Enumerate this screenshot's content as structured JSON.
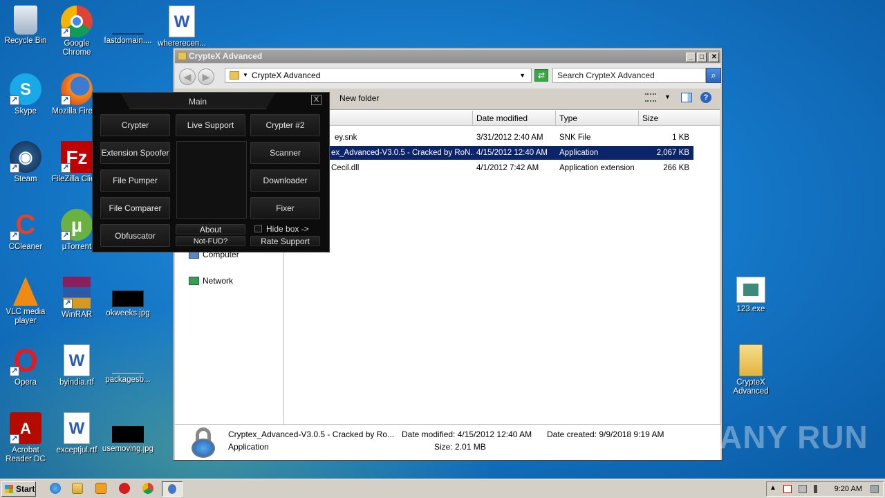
{
  "desktop_icons": [
    {
      "label": "Recycle Bin",
      "icon": "recycle-bin-icon"
    },
    {
      "label": "Google Chrome",
      "icon": "chrome-icon"
    },
    {
      "label": "fastdomain....",
      "icon": "image-file-icon"
    },
    {
      "label": "wherereceп...",
      "icon": "word-doc-icon"
    },
    {
      "label": "Skype",
      "icon": "skype-icon"
    },
    {
      "label": "Mozilla Firef...",
      "icon": "firefox-icon"
    },
    {
      "label": "Steam",
      "icon": "steam-icon"
    },
    {
      "label": "FileZilla Clie...",
      "icon": "filezilla-icon"
    },
    {
      "label": "CCleaner",
      "icon": "ccleaner-icon"
    },
    {
      "label": "µTorrent",
      "icon": "utorrent-icon"
    },
    {
      "label": "VLC media player",
      "icon": "vlc-icon"
    },
    {
      "label": "WinRAR",
      "icon": "winrar-icon"
    },
    {
      "label": "okweeks.jpg",
      "icon": "image-file-icon"
    },
    {
      "label": "Opera",
      "icon": "opera-icon"
    },
    {
      "label": "byindia.rtf",
      "icon": "word-doc-icon"
    },
    {
      "label": "packagesb...",
      "icon": "image-file-icon"
    },
    {
      "label": "Acrobat Reader DC",
      "icon": "acrobat-icon"
    },
    {
      "label": "exceptjul.rtf",
      "icon": "word-doc-icon"
    },
    {
      "label": "usemoving.jpg",
      "icon": "image-file-icon"
    },
    {
      "label": "123.exe",
      "icon": "exe-file-icon"
    },
    {
      "label": "CrypteX Advanced",
      "icon": "folder-icon"
    }
  ],
  "explorer": {
    "title": "CrypteX Advanced",
    "address": "CrypteX Advanced",
    "search_placeholder": "Search CrypteX Advanced",
    "toolbar": {
      "new_folder": "New folder"
    },
    "nav": [
      {
        "label": "Computer"
      },
      {
        "label": "Network"
      }
    ],
    "columns": [
      "Date modified",
      "Type",
      "Size"
    ],
    "files": [
      {
        "name": "ey.snk",
        "date": "3/31/2012 2:40 AM",
        "type": "SNK File",
        "size": "1 KB",
        "selected": false
      },
      {
        "name": "ex_Advanced-V3.0.5 - Cracked by RoN...",
        "date": "4/15/2012 12:40 AM",
        "type": "Application",
        "size": "2,067 KB",
        "selected": true
      },
      {
        "name": "Cecil.dll",
        "date": "4/1/2012 7:42 AM",
        "type": "Application extension",
        "size": "266 KB",
        "selected": false
      }
    ],
    "details": {
      "filename": "Cryptex_Advanced-V3.0.5 - Cracked by Ro...",
      "type": "Application",
      "modified": "Date modified: 4/15/2012 12:40 AM",
      "size": "Size: 2.01 MB",
      "created": "Date created: 9/9/2018 9:19 AM"
    }
  },
  "crypter": {
    "title": "Main",
    "close": "X",
    "buttons": {
      "crypter": "Crypter",
      "live_support": "Live Support",
      "crypter2": "Crypter #2",
      "extension_spoofer": "Extension Spoofer",
      "scanner": "Scanner",
      "file_pumper": "File Pumper",
      "downloader": "Downloader",
      "file_comparer": "File Comparer",
      "fixer": "Fixer",
      "obfuscator": "Obfuscator",
      "about": "About",
      "not_fud": "Not-FUD?",
      "hide_box": "Hide box ->",
      "rate_support": "Rate Support"
    }
  },
  "watermark": "ANY RUN",
  "taskbar": {
    "start": "Start",
    "clock": "9:20 AM"
  },
  "colors": {
    "selection": "#0b246a",
    "desktop": "#1578c8",
    "panel": "#0c0c0c"
  }
}
